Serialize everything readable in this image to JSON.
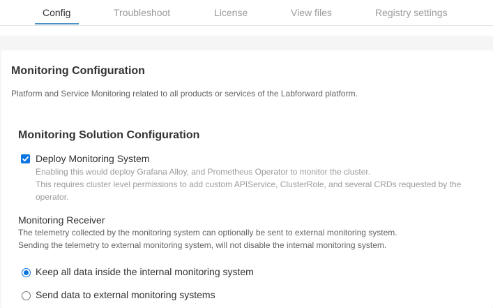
{
  "tabs": [
    {
      "label": "Config",
      "active": true
    },
    {
      "label": "Troubleshoot",
      "active": false
    },
    {
      "label": "License",
      "active": false
    },
    {
      "label": "View files",
      "active": false
    },
    {
      "label": "Registry settings",
      "active": false
    }
  ],
  "section": {
    "title": "Monitoring Configuration",
    "description": "Platform and Service Monitoring related to all products or services of the Labforward platform."
  },
  "solution": {
    "title": "Monitoring Solution Configuration",
    "deploy_checkbox": {
      "label": "Deploy Monitoring System",
      "checked": true,
      "help_lines": [
        "Enabling this would deploy Grafana Alloy, and Prometheus Operator to monitor the cluster.",
        "This requires cluster level permissions to add custom APIService, ClusterRole, and several CRDs requested by the",
        "operator."
      ]
    }
  },
  "receiver": {
    "title": "Monitoring Receiver",
    "description_lines": [
      "The telemetry collected by the monitoring system can optionally be sent to external monitoring system.",
      "Sending the telemetry to external monitoring system, will not disable the internal monitoring system."
    ],
    "options": [
      {
        "label": "Keep all data inside the internal monitoring system",
        "selected": true
      },
      {
        "label": "Send data to external monitoring systems",
        "selected": false
      }
    ]
  },
  "colors": {
    "accent": "#0a75e1",
    "tab_underline": "#4a90c2",
    "page_background": "#f5f5f5"
  }
}
